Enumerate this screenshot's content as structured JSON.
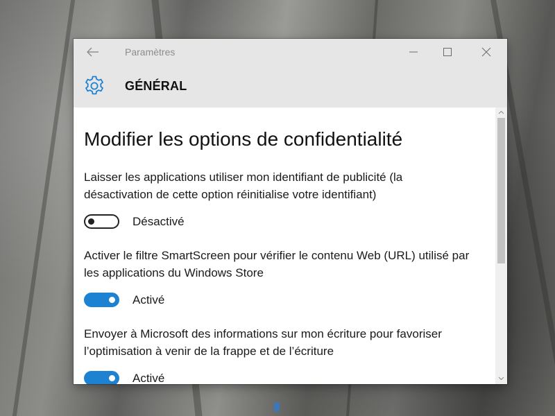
{
  "window": {
    "title": "Paramètres",
    "back_icon": "back-arrow-icon",
    "minimize_icon": "minimize-icon",
    "maximize_icon": "maximize-icon",
    "close_icon": "close-icon"
  },
  "header": {
    "icon": "gear-icon",
    "title": "GÉNÉRAL",
    "accent_color": "#1e82d2"
  },
  "page": {
    "title": "Modifier les options de confidentialité"
  },
  "options": [
    {
      "description": "Laisser les applications utiliser mon identifiant de publicité (la désactivation de cette option réinitialise votre identifiant)",
      "enabled": false,
      "state_label": "Désactivé"
    },
    {
      "description": "Activer le filtre SmartScreen pour vérifier le contenu Web (URL) utilisé par les applications du Windows Store",
      "enabled": true,
      "state_label": "Activé"
    },
    {
      "description": "Envoyer à Microsoft des informations sur mon écriture pour favoriser l’optimisation à venir de la frappe et de l’écriture",
      "enabled": true,
      "state_label": "Activé"
    }
  ],
  "colors": {
    "titlebar": "#e6e6e6",
    "toggle_on": "#1e82d2",
    "toggle_off_border": "#222222"
  }
}
